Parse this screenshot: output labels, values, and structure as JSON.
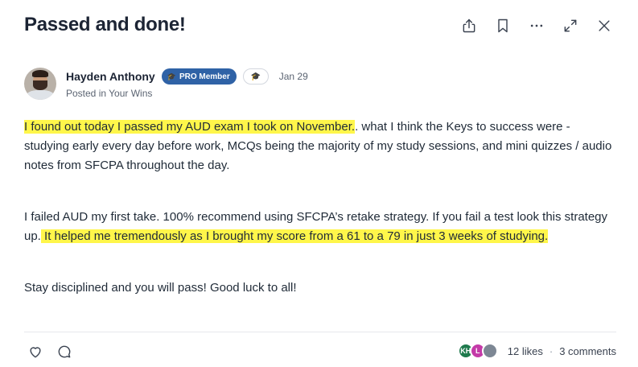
{
  "post": {
    "title": "Passed and done!",
    "author": {
      "name": "Hayden Anthony",
      "badge": "PRO Member",
      "date": "Jan 29",
      "posted_in": "Posted in Your Wins"
    },
    "body": {
      "p1_highlight": "I found out today I passed my AUD exam I took on November.",
      "p1_rest": ". what I think the Keys to success were - studying early every day before work, MCQs being the majority of my study sessions, and mini quizzes / audio notes from SFCPA throughout the day.",
      "p2_plain": "I failed AUD my first take. 100% recommend using SFCPA’s retake strategy. If you fail a test look this strategy up.",
      "p2_highlight": " It helped me tremendously as I brought my score from a 61 to a 79 in just 3 weeks of studying.",
      "p3": "Stay disciplined and you will pass! Good luck to all!"
    },
    "likers": [
      {
        "initials": "KH",
        "color": "#1f7a4d"
      },
      {
        "initials": "L",
        "color": "#c43aa8"
      },
      {
        "initials": "",
        "color": "#7d8794"
      }
    ],
    "likes": "12 likes",
    "separator": "·",
    "comments": "3 comments"
  },
  "icons": {
    "share": "share-icon",
    "bookmark": "bookmark-icon",
    "more": "more-icon",
    "expand": "expand-icon",
    "close": "close-icon",
    "like": "heart-icon",
    "comment": "comment-icon"
  },
  "colors": {
    "highlight": "#fff64a",
    "pro_badge": "#2f62a6"
  }
}
